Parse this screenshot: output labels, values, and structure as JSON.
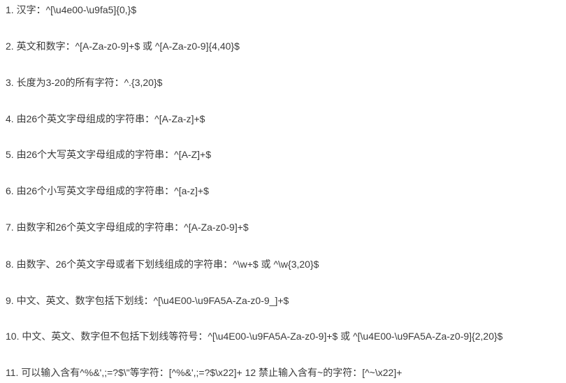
{
  "items": [
    "1. 汉字：^[\\u4e00-\\u9fa5]{0,}$",
    "2. 英文和数字：^[A-Za-z0-9]+$ 或 ^[A-Za-z0-9]{4,40}$",
    "3. 长度为3-20的所有字符：^.{3,20}$",
    "4. 由26个英文字母组成的字符串：^[A-Za-z]+$",
    "5. 由26个大写英文字母组成的字符串：^[A-Z]+$",
    "6. 由26个小写英文字母组成的字符串：^[a-z]+$",
    "7. 由数字和26个英文字母组成的字符串：^[A-Za-z0-9]+$",
    "8. 由数字、26个英文字母或者下划线组成的字符串：^\\w+$ 或 ^\\w{3,20}$",
    "9. 中文、英文、数字包括下划线：^[\\u4E00-\\u9FA5A-Za-z0-9_]+$",
    "10. 中文、英文、数字但不包括下划线等符号：^[\\u4E00-\\u9FA5A-Za-z0-9]+$ 或 ^[\\u4E00-\\u9FA5A-Za-z0-9]{2,20}$",
    "11. 可以输入含有^%&',;=?$\\\"等字符：[^%&',;=?$\\x22]+ 12 禁止输入含有~的字符：[^~\\x22]+"
  ]
}
